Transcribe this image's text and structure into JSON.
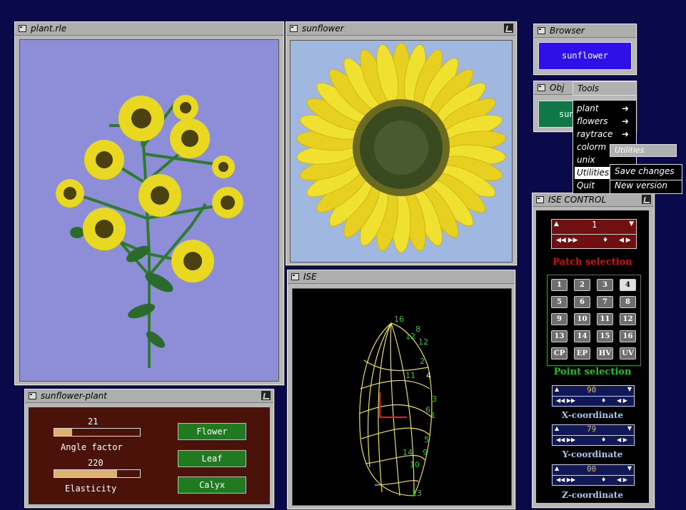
{
  "windows": {
    "plant": {
      "title": "plant.rle"
    },
    "sunflower": {
      "title": "sunflower"
    },
    "ise": {
      "title": "ISE"
    },
    "browser": {
      "title": "Browser",
      "button": "sunflower"
    },
    "obj": {
      "title": "Obj",
      "button": "sun"
    },
    "control": {
      "title": "ISE CONTROL"
    },
    "sfplant": {
      "title": "sunflower-plant"
    }
  },
  "tools_menu": {
    "title": "Tools",
    "items": [
      "plant",
      "flowers",
      "raytrace",
      "colorm",
      "unix",
      "Utilities",
      "Quit"
    ]
  },
  "utilities_menu": {
    "title": "Utilities",
    "items": [
      "Save changes",
      "New version"
    ]
  },
  "sliders": [
    {
      "value": "21",
      "label": "Angle factor",
      "fill": 0.21
    },
    {
      "value": "220",
      "label": "Elasticity",
      "fill": 0.73
    }
  ],
  "part_buttons": [
    "Flower",
    "Leaf",
    "Calyx"
  ],
  "control": {
    "patch_value": "1",
    "patch_label": "Patch selection",
    "patch_grid": [
      "1",
      "2",
      "3",
      "4",
      "5",
      "6",
      "7",
      "8",
      "9",
      "10",
      "11",
      "12",
      "13",
      "14",
      "15",
      "16"
    ],
    "mode_buttons": [
      "CP",
      "EP",
      "HV",
      "UV"
    ],
    "point_label": "Point selection",
    "x_value": "90",
    "x_label": "X-coordinate",
    "y_value": "79",
    "y_label": "Y-coordinate",
    "z_value": "00",
    "z_label": "Z-coordinate"
  },
  "ise_labels": [
    "16",
    "8",
    "12",
    "12",
    "2",
    "11",
    "4",
    "3",
    "6",
    "1",
    "5",
    "14",
    "9",
    "10",
    "13"
  ],
  "colors": {
    "desktop": "#0a0a4a",
    "viewport": "#8e8ed8",
    "accent_red": "#cc1010",
    "accent_green": "#20c020"
  }
}
